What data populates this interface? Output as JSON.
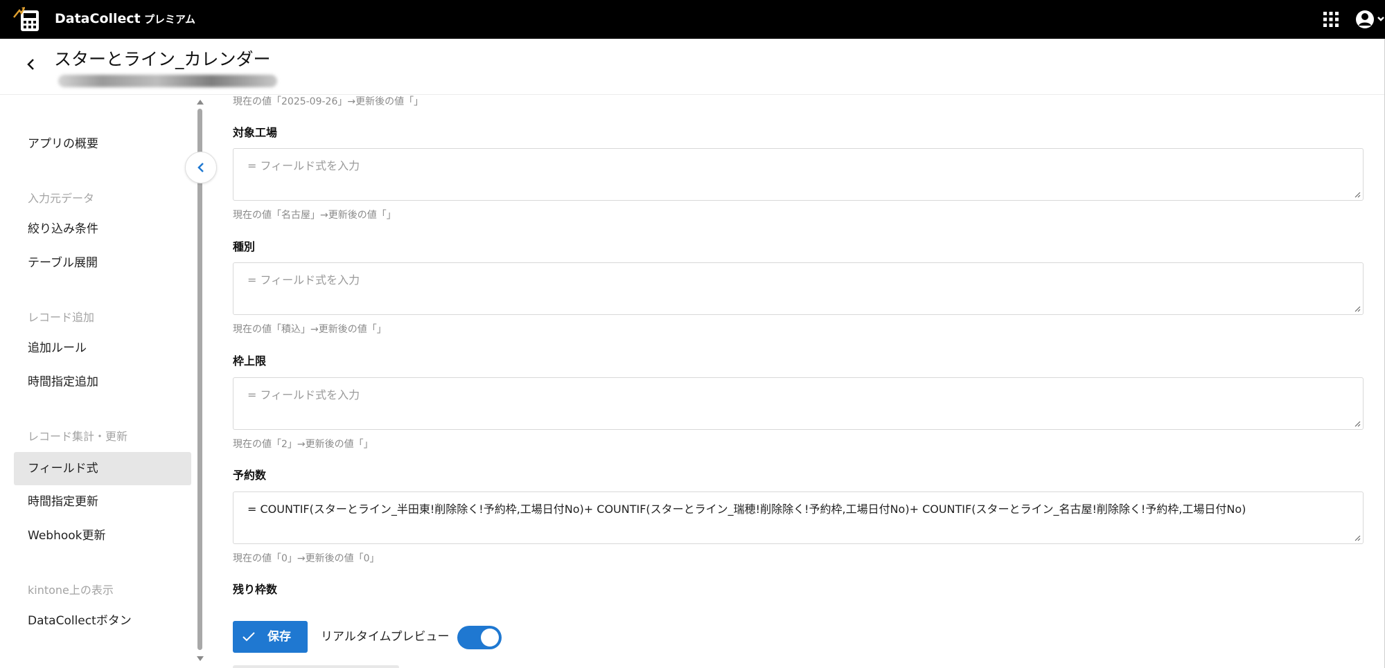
{
  "topbar": {
    "brand": "DataCollect",
    "tier": "プレミアム",
    "icons": [
      "logo-icon",
      "apps-grid-icon",
      "account-icon",
      "chevron-down-icon"
    ],
    "background": "#000000"
  },
  "header": {
    "title": "スターとライン_カレンダー",
    "subtitle_blurred": true
  },
  "sidebar": {
    "items": [
      {
        "label": "アプリの概要"
      },
      {
        "section": "入力元データ"
      },
      {
        "label": "絞り込み条件"
      },
      {
        "label": "テーブル展開"
      },
      {
        "section": "レコード追加"
      },
      {
        "label": "追加ルール"
      },
      {
        "label": "時間指定追加"
      },
      {
        "section": "レコード集計・更新"
      },
      {
        "label": "フィールド式",
        "active": true
      },
      {
        "label": "時間指定更新"
      },
      {
        "label": "Webhook更新"
      },
      {
        "section": "kintone上の表示"
      },
      {
        "label": "DataCollectボタン"
      }
    ]
  },
  "content": {
    "top_hint": "現在の値「2025-09-26」→更新後の値「」",
    "fields": [
      {
        "label": "対象工場",
        "placeholder": "= フィールド式を入力",
        "value": "",
        "hint": "現在の値「名古屋」→更新後の値「」"
      },
      {
        "label": "種別",
        "placeholder": "= フィールド式を入力",
        "value": "",
        "hint": "現在の値「積込」→更新後の値「」"
      },
      {
        "label": "枠上限",
        "placeholder": "= フィールド式を入力",
        "value": "",
        "hint": "現在の値「2」→更新後の値「」"
      },
      {
        "label": "予約数",
        "placeholder": "= フィールド式を入力",
        "value": "= COUNTIF(スターとライン_半田東!削除除く!予約枠,工場日付No)+ COUNTIF(スターとライン_瑞穂!削除除く!予約枠,工場日付No)+ COUNTIF(スターとライン_名古屋!削除除く!予約枠,工場日付No)",
        "hint": "現在の値「0」→更新後の値「0」"
      }
    ],
    "last_label": "残り枠数",
    "save_label": "保存",
    "realtime_label": "リアルタイムプレビュー",
    "realtime_on": true,
    "accent": "#1f78d1"
  }
}
